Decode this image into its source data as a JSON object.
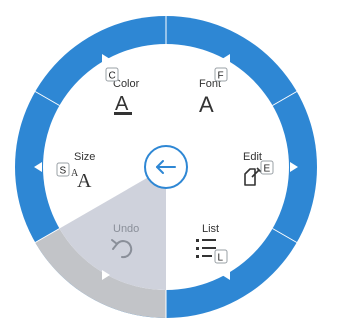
{
  "colors": {
    "ring": "#2e87d4",
    "ring_disabled": "#c2c4c8",
    "disabled_sector": "#cfd2dc",
    "center_icon": "#2e87d4",
    "text": "#333333",
    "text_disabled": "#8a8f99"
  },
  "center": {
    "icon": "arrow-left-icon"
  },
  "items": [
    {
      "id": "color",
      "label": "Color",
      "key": "C",
      "icon": "font-color-icon",
      "icon_glyph": "A",
      "enabled": true
    },
    {
      "id": "font",
      "label": "Font",
      "key": "F",
      "icon": "font-icon",
      "icon_glyph": "A",
      "enabled": true
    },
    {
      "id": "edit",
      "label": "Edit",
      "key": "E",
      "icon": "edit-icon",
      "enabled": true
    },
    {
      "id": "list",
      "label": "List",
      "key": "L",
      "icon": "list-icon",
      "enabled": true
    },
    {
      "id": "undo",
      "label": "Undo",
      "key": "",
      "icon": "undo-icon",
      "enabled": false
    },
    {
      "id": "size",
      "label": "Size",
      "key": "S",
      "icon": "font-size-icon",
      "icon_glyph": "A",
      "icon_glyph_small": "A",
      "enabled": true
    }
  ]
}
